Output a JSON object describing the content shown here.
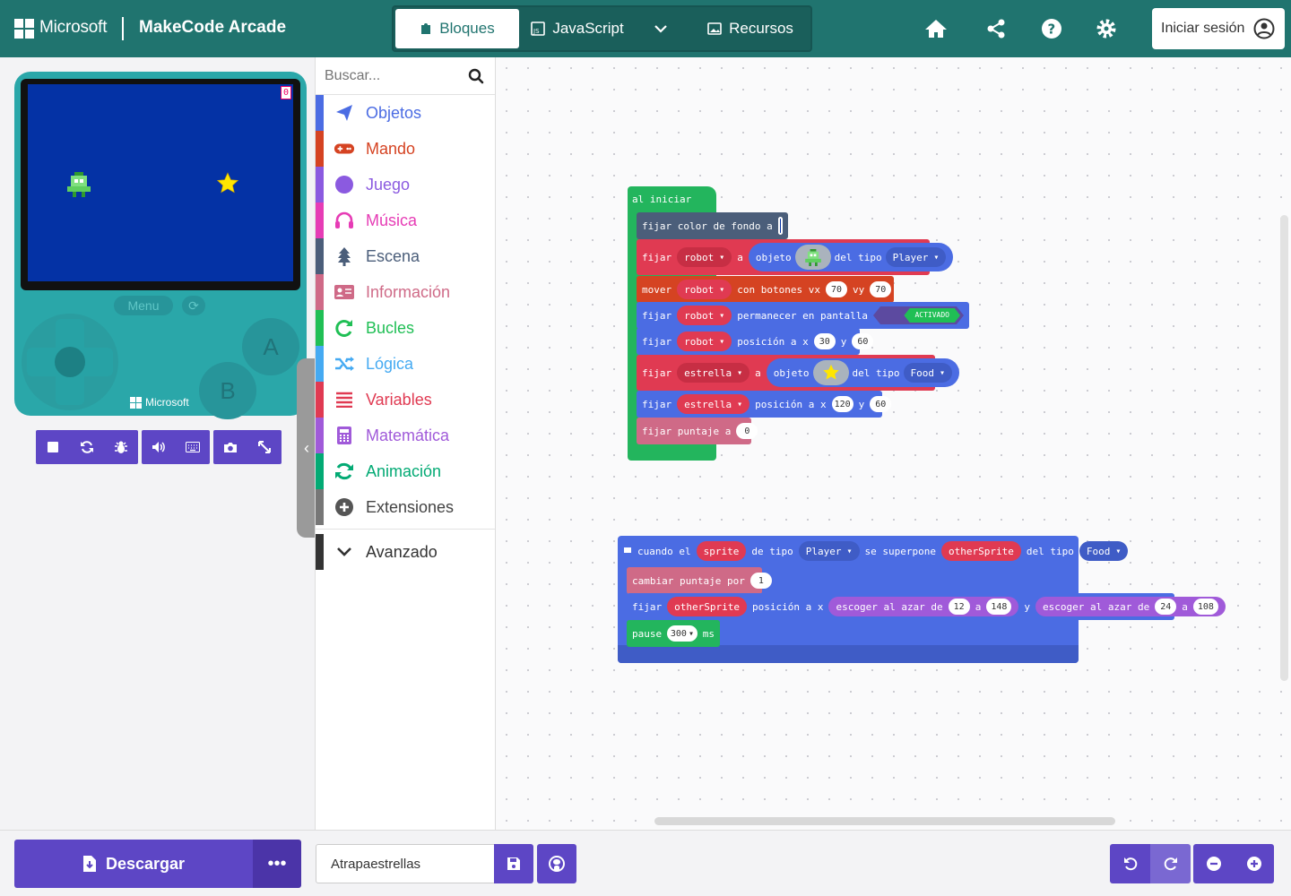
{
  "header": {
    "brand": "Microsoft",
    "app_name": "MakeCode Arcade",
    "tabs": {
      "blocks": "Bloques",
      "javascript": "JavaScript",
      "assets": "Recursos"
    },
    "signin": "Iniciar sesión",
    "accent": "#20746f"
  },
  "simulator": {
    "score": "0",
    "menu_label": "Menu",
    "a_label": "A",
    "b_label": "B",
    "console_brand": "Microsoft",
    "screen_color": "#0432a5"
  },
  "toolbox": {
    "search_placeholder": "Buscar...",
    "categories": [
      {
        "label": "Objetos",
        "color": "#4b6ce3",
        "icon": "paper-plane-icon"
      },
      {
        "label": "Mando",
        "color": "#d54322",
        "icon": "gamepad-icon"
      },
      {
        "label": "Juego",
        "color": "#8b5ae0",
        "icon": "circle-icon"
      },
      {
        "label": "Música",
        "color": "#e63cb5",
        "icon": "headphones-icon"
      },
      {
        "label": "Escena",
        "color": "#4b5e7a",
        "icon": "tree-icon"
      },
      {
        "label": "Información",
        "color": "#cf6a87",
        "icon": "id-card-icon"
      },
      {
        "label": "Bucles",
        "color": "#20bf55",
        "icon": "loop-icon"
      },
      {
        "label": "Lógica",
        "color": "#45aaf2",
        "icon": "shuffle-icon"
      },
      {
        "label": "Variables",
        "color": "#e03a52",
        "icon": "list-icon"
      },
      {
        "label": "Matemática",
        "color": "#a05ad9",
        "icon": "calculator-icon"
      },
      {
        "label": "Animación",
        "color": "#03aa74",
        "icon": "refresh-icon"
      },
      {
        "label": "Extensiones",
        "color": "#666666",
        "icon": "plus-circle-icon"
      }
    ],
    "advanced": "Avanzado"
  },
  "blocks": {
    "on_start": "al iniciar",
    "set_bg": "fijar color de fondo a",
    "set": "fijar",
    "a": "a",
    "sprite": "objeto",
    "of_kind": "del tipo",
    "player": "Player",
    "food": "Food",
    "robot": "robot",
    "star": "estrella",
    "move": "mover",
    "with_buttons": "con botones vx",
    "vy": "vy",
    "vx_val": "70",
    "vy_val": "70",
    "stay_in_screen": "permanecer en pantalla",
    "on": "ACTIVADO",
    "position": "posición a x",
    "y": "y",
    "robot_x": "30",
    "robot_y": "60",
    "star_x": "120",
    "star_y": "60",
    "set_score": "fijar puntaje a",
    "score_val": "0",
    "when": "cuando el",
    "sprite_var": "sprite",
    "of_type": "de tipo",
    "overlaps": "se superpone",
    "other_sprite": "otherSprite",
    "change_score": "cambiar puntaje por",
    "change_val": "1",
    "pick_random": "escoger al azar de",
    "to": "a",
    "rx1": "12",
    "rx2": "148",
    "ry1": "24",
    "ry2": "108",
    "pause": "pause",
    "pause_val": "300",
    "ms": "ms"
  },
  "footer": {
    "download": "Descargar",
    "more": "•••",
    "project_name": "Atrapaestrellas"
  }
}
